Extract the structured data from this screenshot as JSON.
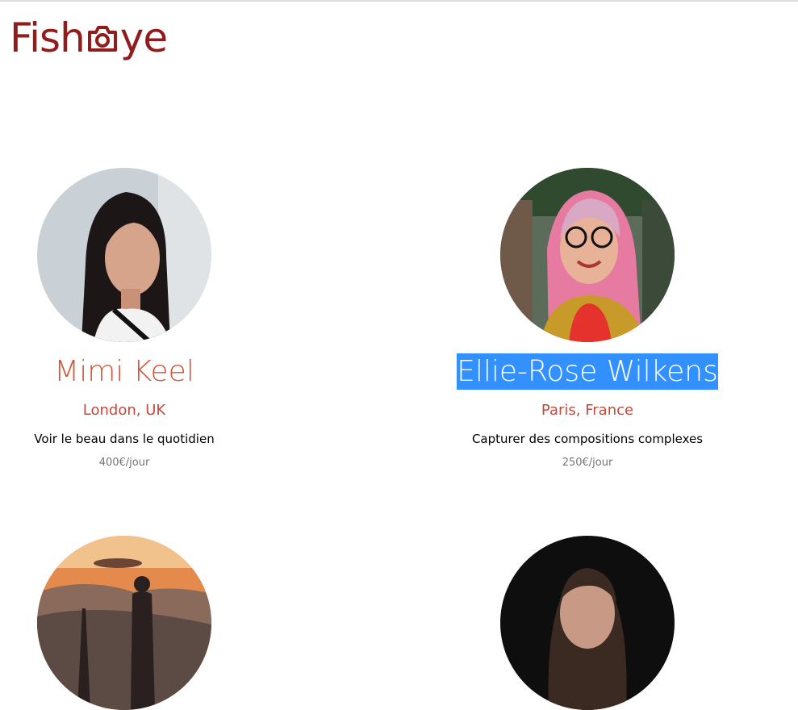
{
  "header": {
    "logo_text_before": "Fish",
    "logo_text_after": "ye"
  },
  "photographers": [
    {
      "name": "Mimi Keel",
      "location": "London, UK",
      "tagline": "Voir le beau dans le quotidien",
      "price": "400€/jour"
    },
    {
      "name": "Ellie-Rose Wilkens",
      "location": "Paris, France",
      "tagline": "Capturer des compositions complexes",
      "price": "250€/jour"
    }
  ],
  "colors": {
    "brand": "#901c1c",
    "name": "#d3573c",
    "location": "#c7483a",
    "selection": "#3390ff"
  },
  "icons": {
    "logo_eye": "camera-icon"
  }
}
